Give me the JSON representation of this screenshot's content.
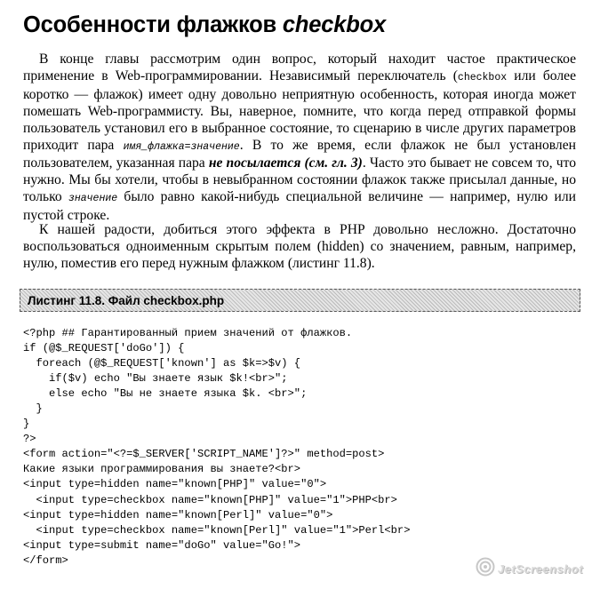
{
  "section": {
    "title": "Особенности флажков",
    "title_italic": "checkbox"
  },
  "paragraph1": {
    "t1": "В конце главы рассмотрим один вопрос, который находит частое практическое применение в Web-программировании. Независимый переключатель (",
    "c1": "checkbox",
    "t2": " или более коротко — флажок) имеет одну довольно неприятную особенность, которая иногда может помешать Web-программисту. Вы, наверное, помните, что когда перед отправкой формы пользователь установил его в выбранное состояние, то сценарию в числе других параметров приходит пара ",
    "c2": "имя_флажка=значение",
    "t3": ". В то же время, если флажок не был установлен пользователем, указанная пара ",
    "b1": "не посылается (см. гл. 3)",
    "t4": ". Часто это бывает не совсем то, что нужно. Мы бы хотели, чтобы в невыбранном состоянии флажок также присылал данные, но только ",
    "c3": "значение",
    "t5": " было равно какой-нибудь специальной величине — например, нулю или пустой строке."
  },
  "paragraph2": "К нашей радости, добиться этого эффекта в PHP довольно несложно. Достаточно воспользоваться одноименным скрытым полем (hidden) со значением, равным, например, нулю, поместив его перед нужным флажком (листинг 11.8).",
  "listing": {
    "title": "Листинг 11.8. Файл checkbox.php",
    "lines": [
      "<?php ## Гарантированный прием значений от флажков.",
      "if (@$_REQUEST['doGo']) {",
      "  foreach (@$_REQUEST['known'] as $k=>$v) {",
      "    if($v) echo \"Вы знаете язык $k!<br>\";",
      "    else echo \"Вы не знаете языка $k. <br>\";",
      "  }",
      "}",
      "?>",
      "<form action=\"<?=$_SERVER['SCRIPT_NAME']?>\" method=post>",
      "Какие языки программирования вы знаете?<br>",
      "<input type=hidden name=\"known[PHP]\" value=\"0\">",
      "  <input type=checkbox name=\"known[PHP]\" value=\"1\">PHP<br>",
      "<input type=hidden name=\"known[Perl]\" value=\"0\">",
      "  <input type=checkbox name=\"known[Perl]\" value=\"1\">Perl<br>",
      "<input type=submit name=\"doGo\" value=\"Go!\">",
      "</form>"
    ]
  },
  "watermark": {
    "text": "JetScreenshot",
    "icon": "camera-lens-icon"
  }
}
